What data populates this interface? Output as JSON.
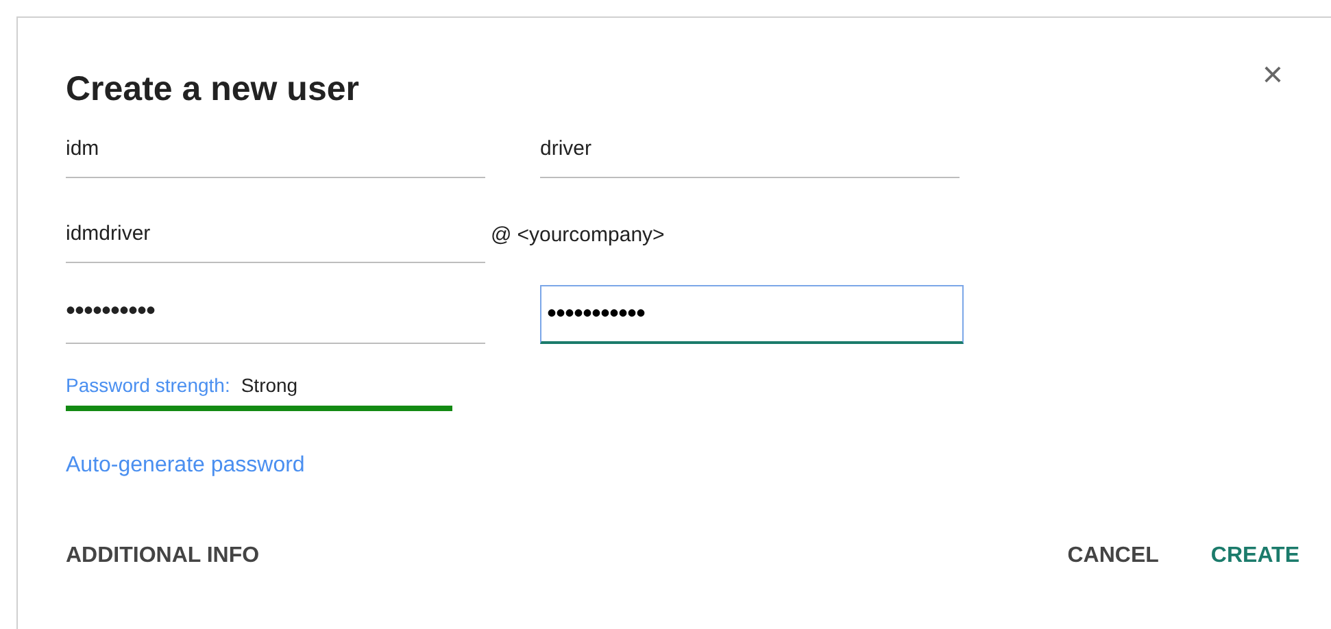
{
  "dialog": {
    "title": "Create a new user",
    "close": "×"
  },
  "fields": [
    {
      "kind": "text",
      "value": "idm",
      "focused": false
    },
    {
      "kind": "text",
      "value": "driver",
      "focused": false
    },
    {
      "kind": "text",
      "value": "idmdriver",
      "focused": false
    },
    {
      "kind": "domain",
      "at": "@",
      "value": "<yourcompany>"
    },
    {
      "kind": "text",
      "value": "••••••••••",
      "focused": false
    },
    {
      "kind": "text",
      "value": "•••••••••••",
      "focused": true
    }
  ],
  "strength": {
    "label": "Password strength:",
    "value": "Strong"
  },
  "link": "Auto-generate password",
  "footer": {
    "left": "ADDITIONAL INFO",
    "buttons": [
      {
        "label": "CANCEL",
        "primary": false
      },
      {
        "label": "CREATE",
        "primary": true
      }
    ]
  }
}
